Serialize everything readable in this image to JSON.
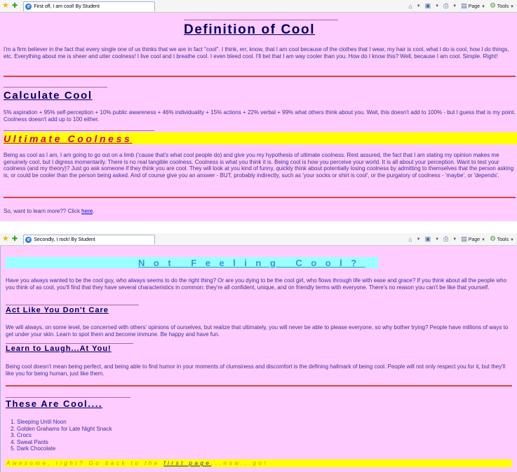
{
  "window1": {
    "tab_title": "First off, I am cool! By Student",
    "page_label": "Page",
    "tools_label": "Tools"
  },
  "window2": {
    "tab_title": "Secondly, I rock! By Student",
    "page_label": "Page",
    "tools_label": "Tools"
  },
  "page1": {
    "heading": "Definition of Cool",
    "intro": "I'm a firm believer in the fact that every single one of us thinks that we are in fact \"cool\". I think, err, know, that I am cool because of the clothes that I wear, my hair is cool, what I do is cool, how I do things, etc. Everything about me is sheer and utter coolness! I live cool and I breathe cool. I even bleed cool. I'll bet that I am way cooler than you. How do I know this? Well, because I am cool. Simple. Right!",
    "calc_heading": "Calculate Cool",
    "calc_text": "5% aspiration + 95% self-perception + 10% public awareness + 46% individuality + 15% actions + 22% verbal + 99% what others think about you. Wait, this doesn't add to 100% - but I guess that is my point. Coolness doesn't add up to 100 either.",
    "ultimate_heading": "Ultimate Coolness",
    "ultimate_text": "Being as cool as I am, I am going to go out on a limb ('cause that's what cool people do) and give you my hypothesis of ultimate coolness. Rest assured, the fact that I am stating my opinion makes me genuinely cool, but I digress momentarily. There is no real tangible coolness. Coolness is what you think it is. Being cool is how you perceive your world. It is all about your perception. Want to test your coolness (and my theory)? Just go ask someone if they think you are cool. They will look at you kind of funny, quickly think about potentially losing coolness by admitting to themselves that the person asking is, or could be cooler than the person being asked. And of course give you an answer - BUT, probably indirectly, such as 'your socks or shirt is cool', or the purgatory of coolness - 'maybe', or 'depends'.",
    "learn_more": "So, want to learn more?? Click ",
    "learn_more_link": "here",
    "learn_more_end": "."
  },
  "page2": {
    "heading": "Not Feeling Cool?",
    "intro": "Have you always wanted to be the cool guy, who always seems to do the right thing? Or are you dying to be the cool girl, who flows through life with ease and grace? If you think about all the people who you think of as cool, you'll find that they have several characteristics in common: they're all confident, unique, and on friendly terms with everyone. There's no reason you can't be like that yourself.",
    "act_heading": "Act Like You Don't Care",
    "act_text": "We will always, on some level, be concerned with others' opinions of ourselves, but realize that ultimately, you will never be able to please everyone, so why bother trying? People have millions of ways to get under your skin. Learn to spot them and become immune. Be happy and have fun.",
    "laugh_heading": "Learn to Laugh...At You!",
    "laugh_text": "Being cool doesn't mean being perfect, and being able to find humor in your moments of clumsiness and discomfort is the defining hallmark of being cool. People will not only respect you for it, but they'll like you for being human, just like them.",
    "cool_heading": "These Are Cool....",
    "cool_list": [
      "Sleeping Until Noon",
      "Golden Grahams for Late Night Snack",
      "Crocs",
      "Sweat Pants",
      "Dark Chocolate"
    ],
    "back_text": "Awesome, right? Go back to the ",
    "back_link": "first page",
    "back_end": "...now...go!"
  },
  "colors": {
    "page_bg": "#ffccff",
    "heading": "#000066",
    "body_text": "#333399",
    "ultimate_heading": "#cc0066",
    "highlight_yellow": "#ffff00",
    "highlight_cyan": "#99ffff",
    "rule_red": "#e04040"
  }
}
